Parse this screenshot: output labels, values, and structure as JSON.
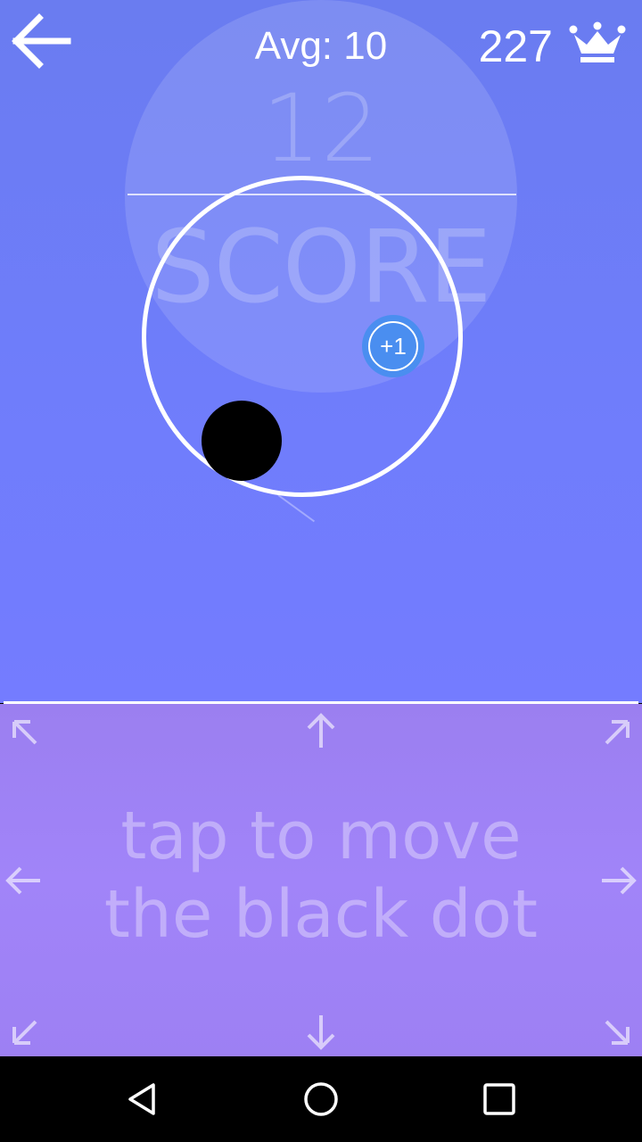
{
  "header": {
    "back_icon": "arrow-left-icon",
    "avg_label": "Avg: 10",
    "best_score": "227",
    "best_icon": "crown-icon"
  },
  "score": {
    "value": "12",
    "label": "SCORE"
  },
  "playfield": {
    "bonus_label": "+1",
    "player": "black-dot",
    "colors": {
      "background": "#6f7dfb",
      "ring": "#ffffff",
      "bonus": "#4a8ef0",
      "player": "#000000"
    }
  },
  "control_pad": {
    "line1": "tap to move",
    "line2": "the black dot",
    "arrows": [
      "up-left-icon",
      "up-icon",
      "up-right-icon",
      "left-icon",
      "right-icon",
      "down-left-icon",
      "down-icon",
      "down-right-icon"
    ],
    "background": "#a184f9"
  },
  "navbar": {
    "buttons": [
      "back-triangle-icon",
      "home-circle-icon",
      "recents-square-icon"
    ]
  }
}
